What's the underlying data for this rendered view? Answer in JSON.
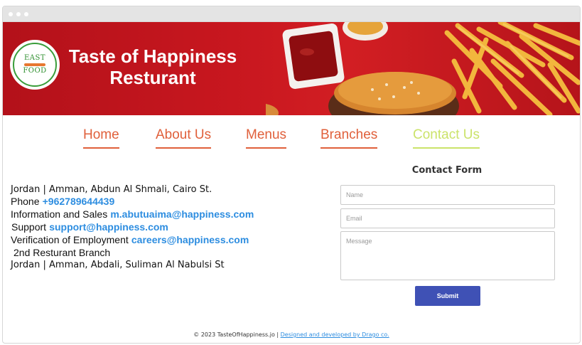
{
  "brand": {
    "title_line1": "Taste of Happiness",
    "title_line2": "Resturant",
    "logo_top": "EAST",
    "logo_bottom": "FOOD"
  },
  "nav": {
    "items": [
      {
        "label": "Home"
      },
      {
        "label": "About Us"
      },
      {
        "label": "Menus"
      },
      {
        "label": "Branches"
      },
      {
        "label": "Contact Us",
        "active": true
      }
    ]
  },
  "contact": {
    "address1": "Jordan | Amman, Abdun Al Shmali, Cairo St.",
    "phone_label": "Phone",
    "phone": "+962789644439",
    "sales_label": "Information and Sales",
    "sales_email": "m.abutuaima@happiness.com",
    "support_label": "Support",
    "support_email": "support@happiness.com",
    "careers_label": "Verification of Employment",
    "careers_email": "careers@happiness.com",
    "branch2_label": "2nd Resturant Branch",
    "address2": "Jordan | Amman, Abdali, Suliman Al Nabulsi St"
  },
  "form": {
    "title": "Contact Form",
    "name_placeholder": "Name",
    "email_placeholder": "Email",
    "message_placeholder": "Message",
    "submit_label": "Submit"
  },
  "footer": {
    "copyright": "© 2023 TasteOfHappiness.jo |",
    "credit_link": "Designed and developed by Drago co."
  },
  "colors": {
    "banner_red": "#c8171f",
    "nav_orange": "#e0603b",
    "nav_active": "#cbe36a",
    "link_blue": "#2d8de0",
    "button_blue": "#3f51b5"
  }
}
